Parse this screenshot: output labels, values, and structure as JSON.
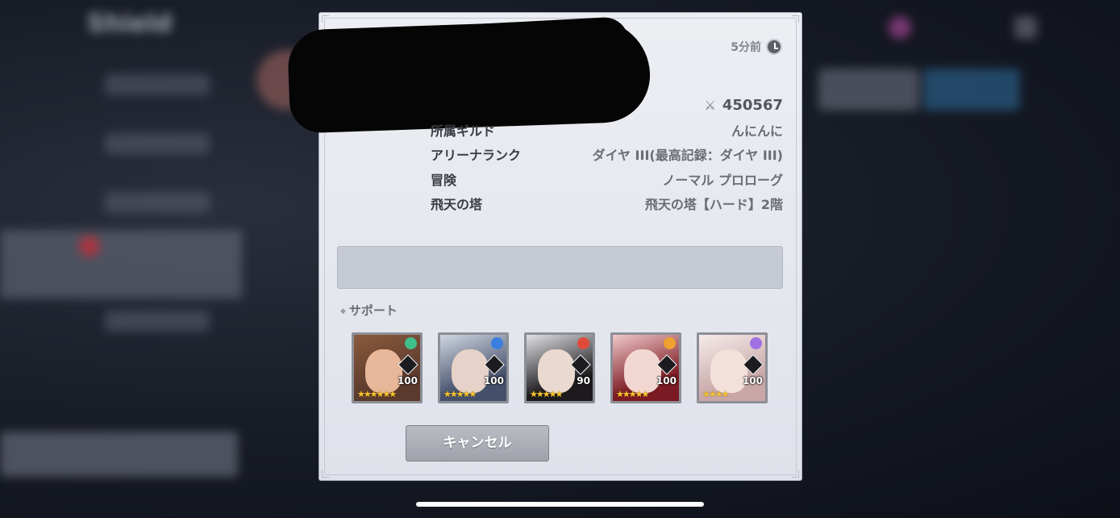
{
  "background": {
    "app_title": "Shield",
    "menu_items": [
      "",
      "",
      "",
      "",
      ""
    ]
  },
  "profile": {
    "time_ago": "5分前",
    "power": "450567",
    "rows": [
      {
        "label": "所属ギルド",
        "value": "んにんに"
      },
      {
        "label": "アリーナランク",
        "value": "ダイヤ III(最高記録：ダイヤ III)"
      },
      {
        "label": "冒険",
        "value": "ノーマル プロローグ"
      },
      {
        "label": "飛天の塔",
        "value": "飛天の塔【ハード】2階"
      }
    ],
    "message": ""
  },
  "support": {
    "label": "サポート",
    "heroes": [
      {
        "level": "100",
        "stars": "★★★★★★",
        "element_color": "#3fbf8a",
        "art_color": "#5b3a2e",
        "face_color": "#e8b79a",
        "hair_color": "#8a5a3c"
      },
      {
        "level": "100",
        "stars": "★★★★★",
        "element_color": "#3a7fe0",
        "art_color": "#44506a",
        "face_color": "#e6d2c8",
        "hair_color": "#d0d6e2"
      },
      {
        "level": "90",
        "stars": "★★★★★",
        "element_color": "#e04a3a",
        "art_color": "#1c1a1c",
        "face_color": "#ead9d0",
        "hair_color": "#e2e2e4"
      },
      {
        "level": "100",
        "stars": "★★★★★",
        "element_color": "#f0a030",
        "art_color": "#7a1a22",
        "face_color": "#f2d6d0",
        "hair_color": "#f0c8c8"
      },
      {
        "level": "100",
        "stars": "★★★★",
        "element_color": "#a070e0",
        "art_color": "#c9a7a8",
        "face_color": "#f4e0da",
        "hair_color": "#f5ecea"
      }
    ]
  },
  "buttons": {
    "cancel": "キャンセル"
  },
  "colors": {
    "modal_bg": "#e6e8ee",
    "cancel_bg": "#a9acb4",
    "star": "#f5c330"
  }
}
